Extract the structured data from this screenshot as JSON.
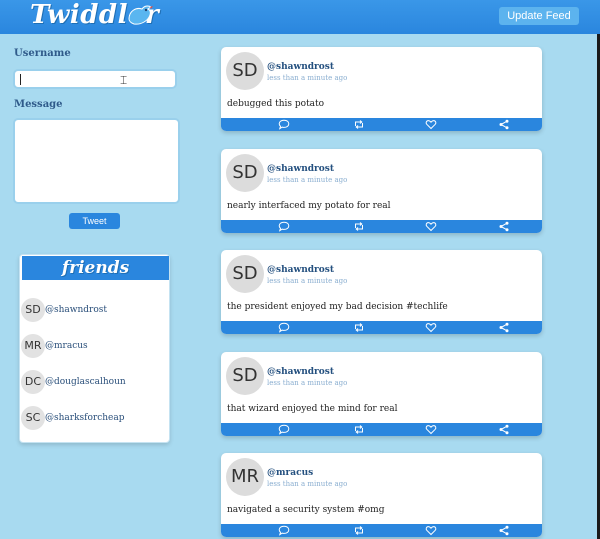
{
  "header": {
    "logo_text": "Twiddler",
    "update_label": "Update Feed"
  },
  "compose": {
    "username_label": "Username",
    "username_value": "",
    "message_label": "Message",
    "message_value": "",
    "tweet_label": "Tweet"
  },
  "friends": {
    "title": "friends",
    "items": [
      {
        "initials": "SD",
        "handle": "@shawndrost"
      },
      {
        "initials": "MR",
        "handle": "@mracus"
      },
      {
        "initials": "DC",
        "handle": "@douglascalhoun"
      },
      {
        "initials": "SC",
        "handle": "@sharksforcheap"
      }
    ]
  },
  "feed": [
    {
      "initials": "SD",
      "user": "@shawndrost",
      "time": "less than a minute ago",
      "text": "debugged this potato"
    },
    {
      "initials": "SD",
      "user": "@shawndrost",
      "time": "less than a minute ago",
      "text": "nearly interfaced my potato for real"
    },
    {
      "initials": "SD",
      "user": "@shawndrost",
      "time": "less than a minute ago",
      "text": "the president enjoyed my bad decision #techlife"
    },
    {
      "initials": "SD",
      "user": "@shawndrost",
      "time": "less than a minute ago",
      "text": "that wizard enjoyed the mind for real"
    },
    {
      "initials": "MR",
      "user": "@mracus",
      "time": "less than a minute ago",
      "text": "navigated a security system #omg"
    }
  ],
  "icons": {
    "comment": "comment-icon",
    "retweet": "retweet-icon",
    "like": "heart-icon",
    "share": "share-icon"
  },
  "colors": {
    "background": "#a8daf0",
    "accent": "#2a86de",
    "header": "#3a97e8",
    "link": "#24507f"
  }
}
